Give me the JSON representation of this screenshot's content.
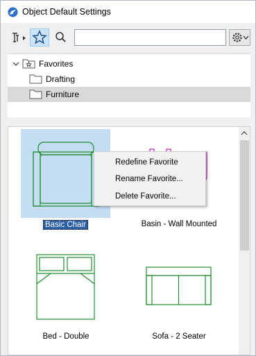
{
  "window": {
    "title": "Object Default Settings"
  },
  "toolbar": {
    "person_icon": "person-object-icon",
    "favorites_icon": "star-icon",
    "search_icon": "search-icon",
    "search": {
      "value": "",
      "placeholder": ""
    },
    "settings_icon": "gear-icon"
  },
  "tree": {
    "items": [
      {
        "label": "Favorites",
        "icon": "star-folder-icon",
        "expanded": true,
        "selected": false
      },
      {
        "label": "Drafting",
        "icon": "folder-icon",
        "selected": false
      },
      {
        "label": "Furniture",
        "icon": "folder-icon",
        "selected": true
      }
    ]
  },
  "gallery": {
    "items": [
      {
        "label": "Basic Chair",
        "icon": "chair-plan-icon",
        "selected": true
      },
      {
        "label": "Basin - Wall Mounted",
        "icon": "basin-plan-icon",
        "selected": false
      },
      {
        "label": "Bed - Double",
        "icon": "double-bed-plan-icon",
        "selected": false
      },
      {
        "label": "Sofa - 2 Seater",
        "icon": "sofa-plan-icon",
        "selected": false
      }
    ]
  },
  "context_menu": {
    "items": [
      {
        "label": "Redefine Favorite"
      },
      {
        "label": "Rename Favorite..."
      },
      {
        "label": "Delete Favorite..."
      }
    ]
  },
  "colors": {
    "symbol_green": "#1a8c2a",
    "symbol_magenta": "#c020c0",
    "selection_blue": "#c4ddf3",
    "label_highlight": "#2b5fa8"
  }
}
